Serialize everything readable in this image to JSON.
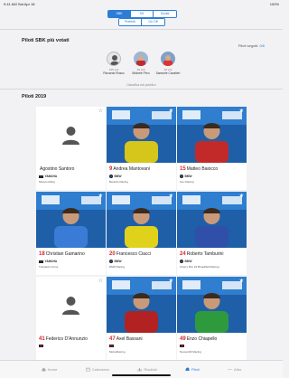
{
  "status": {
    "time": "9:41 AM",
    "date": "Sat Apr 18",
    "battery": "100%"
  },
  "segments": {
    "tabs": [
      "SBK",
      "SS",
      "Social"
    ],
    "active": "SBK",
    "sub_tabs": [
      "Preferiti",
      "On Off"
    ]
  },
  "top_section": {
    "title": "Piloti SBK più votati",
    "followed_label": "Piloti seguiti:",
    "followed_count": "0/6",
    "riders": [
      {
        "votes": "435 voti",
        "name": "Riccardo Russo",
        "avatar": "anon"
      },
      {
        "votes": "49 voti",
        "name": "Michele Pirro",
        "avatar": "photo-red"
      },
      {
        "votes": "23 voti",
        "name": "Samuele Cavalieri",
        "avatar": "photo-red"
      }
    ],
    "ranking_link": "Classifica voti pubblico"
  },
  "riders_section": {
    "title": "Piloti 2019",
    "cards": [
      {
        "number": "",
        "name": "Agostino Santoro",
        "brand": "YAMAHA",
        "brand_logo": "yam",
        "team": "Motocorsiting",
        "photo": "anon",
        "favorite": false,
        "suit": "#888888"
      },
      {
        "number": "9",
        "name": "Andrea Mantovani",
        "brand": "BMW",
        "brand_logo": "bmw",
        "team": "Berardo Racing",
        "photo": "rider",
        "favorite": true,
        "suit": "#d6c51a"
      },
      {
        "number": "15",
        "name": "Matteo Baiocco",
        "brand": "BMW",
        "brand_logo": "bmw",
        "team": "Gev Racing",
        "photo": "rider",
        "favorite": true,
        "suit": "#c22a2a"
      },
      {
        "number": "18",
        "name": "Christian Gamarino",
        "brand": "YAMAHA",
        "brand_logo": "yam",
        "team": "Tufoparts Corse",
        "photo": "rider",
        "favorite": true,
        "suit": "#3a7bd5"
      },
      {
        "number": "20",
        "name": "Francesco Ciacci",
        "brand": "BMW",
        "brand_logo": "bmw",
        "team": "DMR Racing",
        "photo": "rider",
        "favorite": true,
        "suit": "#e0d21a"
      },
      {
        "number": "24",
        "name": "Roberto Tamburini",
        "brand": "BMW",
        "brand_logo": "bmw",
        "team": "Cherry Box 24 Broadfield Racing",
        "photo": "rider",
        "favorite": true,
        "suit": "#2f4fa8"
      },
      {
        "number": "41",
        "name": "Federico D'Annunzio",
        "brand": "",
        "brand_logo": "duc",
        "team": "",
        "photo": "anon",
        "favorite": false,
        "suit": "#888888"
      },
      {
        "number": "47",
        "name": "Axel Bassani",
        "brand": "",
        "brand_logo": "duc",
        "team": "MotoxRacing",
        "photo": "rider",
        "favorite": true,
        "suit": "#b22222"
      },
      {
        "number": "49",
        "name": "Enzo Chiapello",
        "brand": "",
        "brand_logo": "duc",
        "team": "Nuova M2 Racing",
        "photo": "rider",
        "favorite": true,
        "suit": "#2e9a3e"
      }
    ]
  },
  "tabbar": {
    "items": [
      {
        "label": "Home",
        "icon": "home-icon"
      },
      {
        "label": "Calendario",
        "icon": "calendar-icon"
      },
      {
        "label": "Risultati",
        "icon": "results-icon"
      },
      {
        "label": "Piloti",
        "icon": "helmet-icon",
        "active": true
      },
      {
        "label": "Altro",
        "icon": "more-icon"
      }
    ]
  }
}
